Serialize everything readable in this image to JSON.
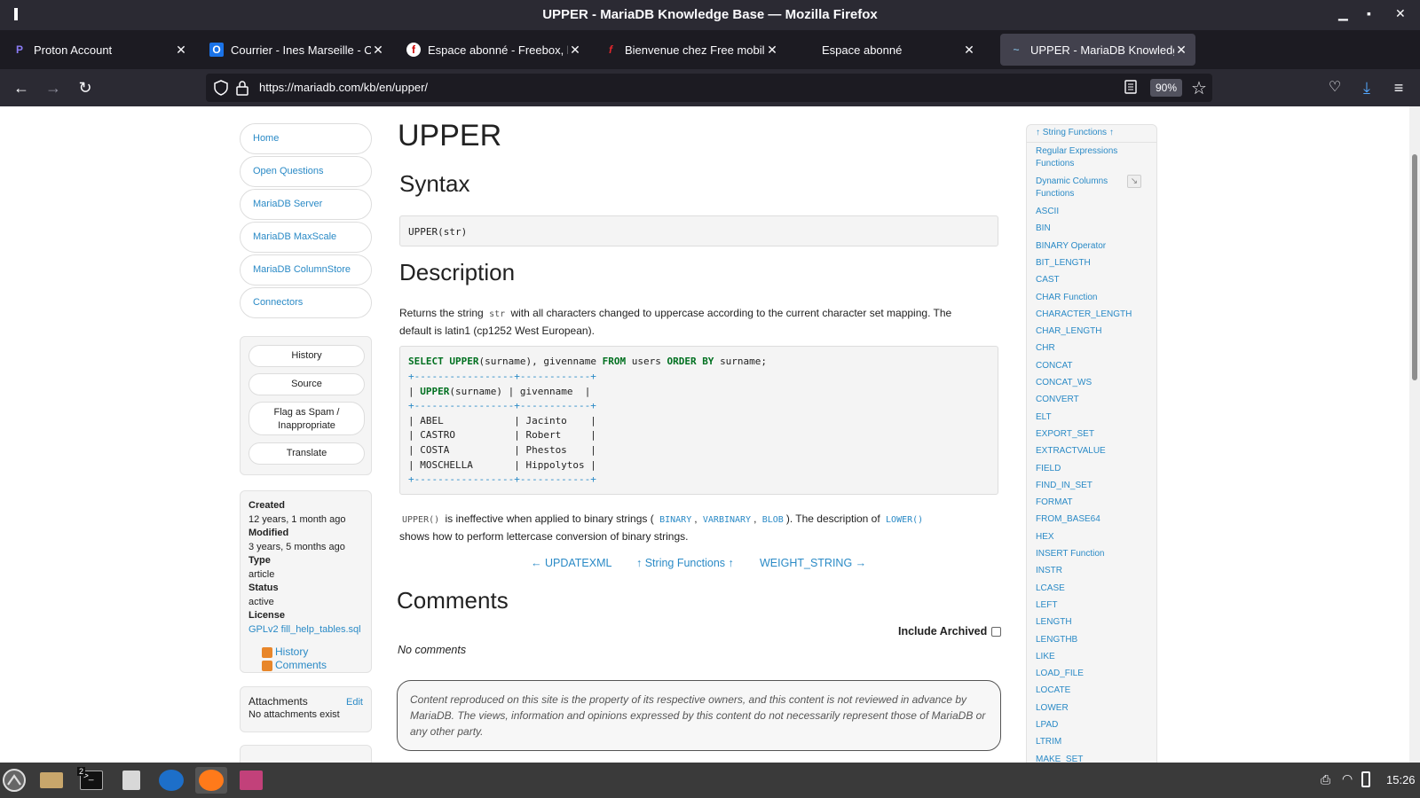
{
  "window": {
    "title": "UPPER - MariaDB Knowledge Base — Mozilla Firefox"
  },
  "tabs": [
    {
      "label": "Proton Account",
      "icon": "proton-icon"
    },
    {
      "label": "Courrier - Ines Marseille - Ou",
      "icon": "outlook-icon"
    },
    {
      "label": "Espace abonné - Freebox, la",
      "icon": "freebox-icon"
    },
    {
      "label": "Bienvenue chez Free mobile",
      "icon": "free-mobile-icon"
    },
    {
      "label": "Espace abonné",
      "icon": "blank-icon"
    },
    {
      "label": "UPPER - MariaDB Knowledge",
      "icon": "mariadb-icon",
      "active": true
    }
  ],
  "navbar": {
    "url": "https://mariadb.com/kb/en/upper/",
    "zoom": "90%"
  },
  "left_nav": [
    "Home",
    "Open Questions",
    "MariaDB Server",
    "MariaDB MaxScale",
    "MariaDB ColumnStore",
    "Connectors"
  ],
  "actions": {
    "history": "History",
    "source": "Source",
    "flag_line1": "Flag as Spam /",
    "flag_line2": "Inappropriate",
    "translate": "Translate"
  },
  "meta": {
    "created_label": "Created",
    "created": "12 years, 1 month ago",
    "modified_label": "Modified",
    "modified": "3 years, 5 months ago",
    "type_label": "Type",
    "type": "article",
    "status_label": "Status",
    "status": "active",
    "license_label": "License",
    "license": "GPLv2 fill_help_tables.sql",
    "feed_history": "History",
    "feed_comments": "Comments"
  },
  "attachments": {
    "title": "Attachments",
    "edit": "Edit",
    "none": "No attachments exist"
  },
  "article": {
    "title": "UPPER",
    "syntax_heading": "Syntax",
    "syntax_code": "UPPER(str)",
    "description_heading": "Description",
    "desc_1": "Returns the string",
    "desc_code": "str",
    "desc_2": "with all characters changed to uppercase according to the current character set mapping. The",
    "desc_3": "default is latin1 (cp1252 West European).",
    "example": {
      "kw_select": "SELECT",
      "kw_upper": "UPPER",
      "q_1": "(surname), givenname",
      "kw_from": "FROM",
      "q_2": "users",
      "kw_order": "ORDER BY",
      "q_3": "surname;",
      "border": "+-----------------+------------+",
      "header_pre": "|",
      "header_fn": "UPPER",
      "header_post": "(surname) | givenname  |",
      "rows": [
        "| ABEL            | Jacinto    |",
        "| CASTRO          | Robert     |",
        "| COSTA           | Phestos    |",
        "| MOSCHELLA       | Hippolytos |"
      ]
    },
    "note_code": "UPPER()",
    "note_1": "is ineffective when applied to binary strings (",
    "note_binary": "BINARY",
    "note_varbinary": "VARBINARY",
    "note_blob": "BLOB",
    "note_2": "). The description of",
    "note_lower": "LOWER()",
    "note_3": "shows how to perform lettercase conversion of binary strings.",
    "prev": "← UPDATEXML",
    "up": "↑ String Functions ↑",
    "next": "WEIGHT_STRING →",
    "comments_heading": "Comments",
    "include_archived": "Include Archived",
    "no_comments": "No comments",
    "disclaimer": "Content reproduced on this site is the property of its respective owners, and this content is not reviewed in advance by MariaDB. The views, information and opinions expressed by this content do not necessarily represent those of MariaDB or any other party."
  },
  "right_sidebar": {
    "header": "↑ String Functions ↑",
    "items": [
      "Regular Expressions Functions",
      "Dynamic Columns Functions",
      "ASCII",
      "BIN",
      "BINARY Operator",
      "BIT_LENGTH",
      "CAST",
      "CHAR Function",
      "CHARACTER_LENGTH",
      "CHAR_LENGTH",
      "CHR",
      "CONCAT",
      "CONCAT_WS",
      "CONVERT",
      "ELT",
      "EXPORT_SET",
      "EXTRACTVALUE",
      "FIELD",
      "FIND_IN_SET",
      "FORMAT",
      "FROM_BASE64",
      "HEX",
      "INSERT Function",
      "INSTR",
      "LCASE",
      "LEFT",
      "LENGTH",
      "LENGTHB",
      "LIKE",
      "LOAD_FILE",
      "LOCATE",
      "LOWER",
      "LPAD",
      "LTRIM",
      "MAKE_SET"
    ]
  },
  "taskbar": {
    "clock": "15:26",
    "terminal_badge": "2"
  }
}
